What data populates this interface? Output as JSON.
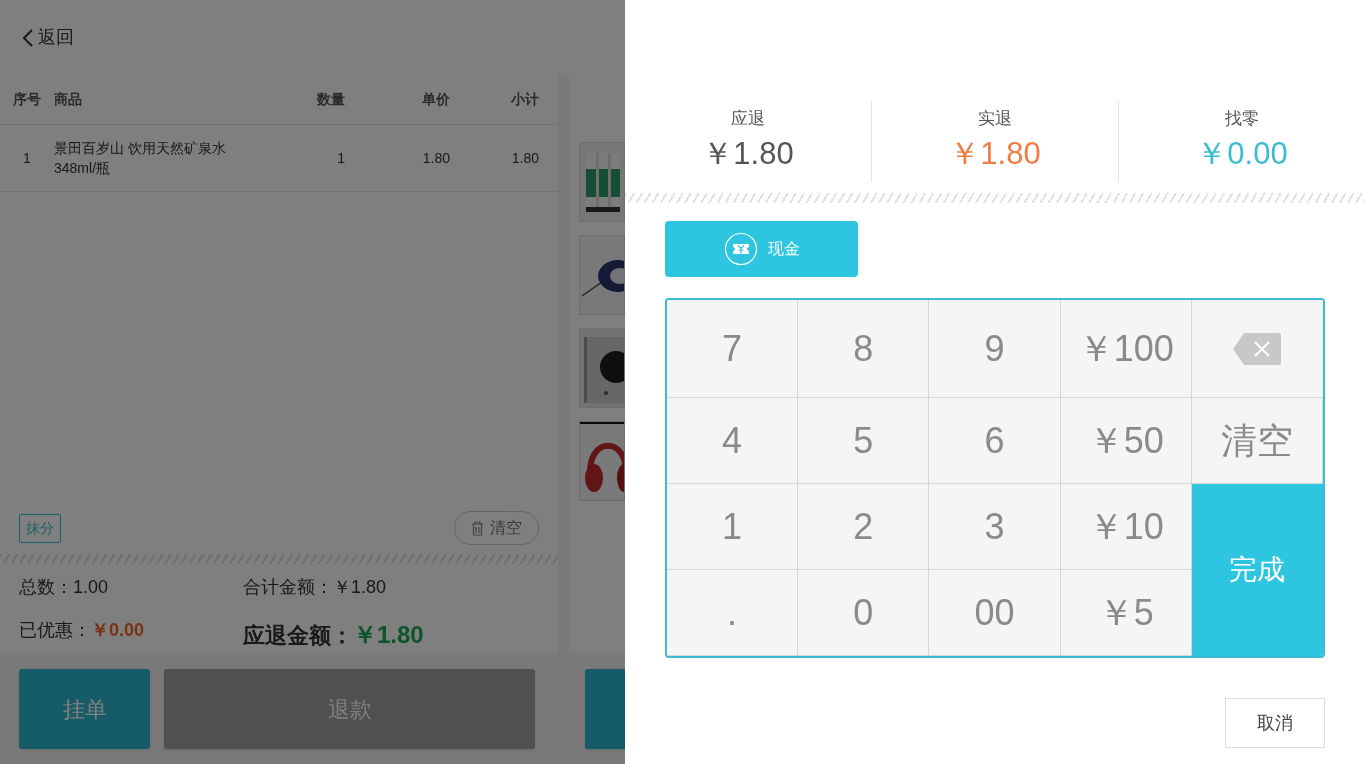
{
  "header": {
    "back_label": "返回"
  },
  "order_table": {
    "columns": [
      "序号",
      "商品",
      "数量",
      "单价",
      "小计"
    ],
    "rows": [
      [
        "1",
        "景田百岁山 饮用天然矿泉水348ml/瓶",
        "1",
        "1.80",
        "1.80"
      ]
    ]
  },
  "order_actions": {
    "tag": "抹分",
    "clear": "清空"
  },
  "order_totals": {
    "count_label": "总数：",
    "count": "1.00",
    "sum_label": "合计金额：",
    "sum": "￥1.80",
    "discount_label": "已优惠：",
    "discount": "￥0.00",
    "due_label": "应退金额：",
    "due": "￥1.80"
  },
  "bottom_buttons": [
    {
      "label": "挂单",
      "kind": "primary"
    },
    {
      "label": "退款",
      "kind": "disabled"
    },
    {
      "kind": "primary"
    }
  ],
  "refund_summary": [
    {
      "label": "应退",
      "amount": "￥1.80",
      "color": "#555555"
    },
    {
      "label": "实退",
      "amount": "￥1.80",
      "color": "#f07c44"
    },
    {
      "label": "找零",
      "amount": "￥0.00",
      "color": "#3bbcd4"
    }
  ],
  "payment_methods": [
    {
      "label": "现金",
      "selected": true
    }
  ],
  "keypad": [
    {
      "label": "7",
      "kind": "key"
    },
    {
      "label": "8",
      "kind": "key"
    },
    {
      "label": "9",
      "kind": "key"
    },
    {
      "label": "￥100",
      "kind": "key"
    },
    {
      "kind": "backspace"
    },
    {
      "label": "4",
      "kind": "key"
    },
    {
      "label": "5",
      "kind": "key"
    },
    {
      "label": "6",
      "kind": "key"
    },
    {
      "label": "￥50",
      "kind": "key"
    },
    {
      "label": "清空",
      "kind": "key"
    },
    {
      "label": "1",
      "kind": "key"
    },
    {
      "label": "2",
      "kind": "key"
    },
    {
      "label": "3",
      "kind": "key"
    },
    {
      "label": "￥10",
      "kind": "key"
    },
    {
      "label": "完成",
      "kind": "done"
    },
    {
      "label": ".",
      "kind": "key"
    },
    {
      "label": "0",
      "kind": "key"
    },
    {
      "label": "00",
      "kind": "key"
    },
    {
      "label": "￥5",
      "kind": "key"
    }
  ],
  "cancel_button": "取消"
}
